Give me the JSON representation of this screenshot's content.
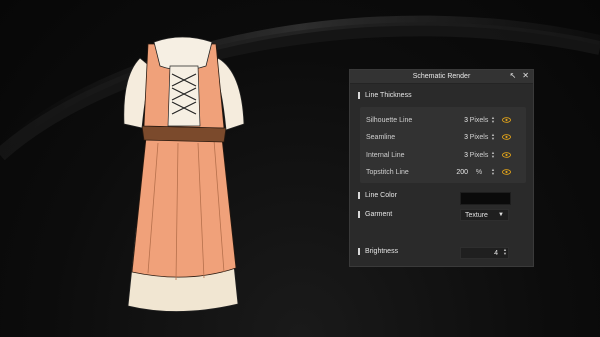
{
  "panel": {
    "title": "Schematic Render",
    "pin_icon": "pin-icon",
    "close_icon": "close-icon",
    "line_thickness_label": "Line Thickness",
    "rows": [
      {
        "label": "Silhouette Line",
        "value": "3",
        "unit": "Pixels"
      },
      {
        "label": "Seamline",
        "value": "3",
        "unit": "Pixels"
      },
      {
        "label": "Internal Line",
        "value": "3",
        "unit": "Pixels"
      },
      {
        "label": "Topstitch Line",
        "value": "200",
        "unit": "%"
      }
    ],
    "line_color_label": "Line Color",
    "line_color_value": "#0a0a0a",
    "garment_label": "Garment",
    "garment_value": "Texture",
    "brightness_label": "Brightness",
    "brightness_value": "4",
    "accent": "#e0a21a"
  }
}
